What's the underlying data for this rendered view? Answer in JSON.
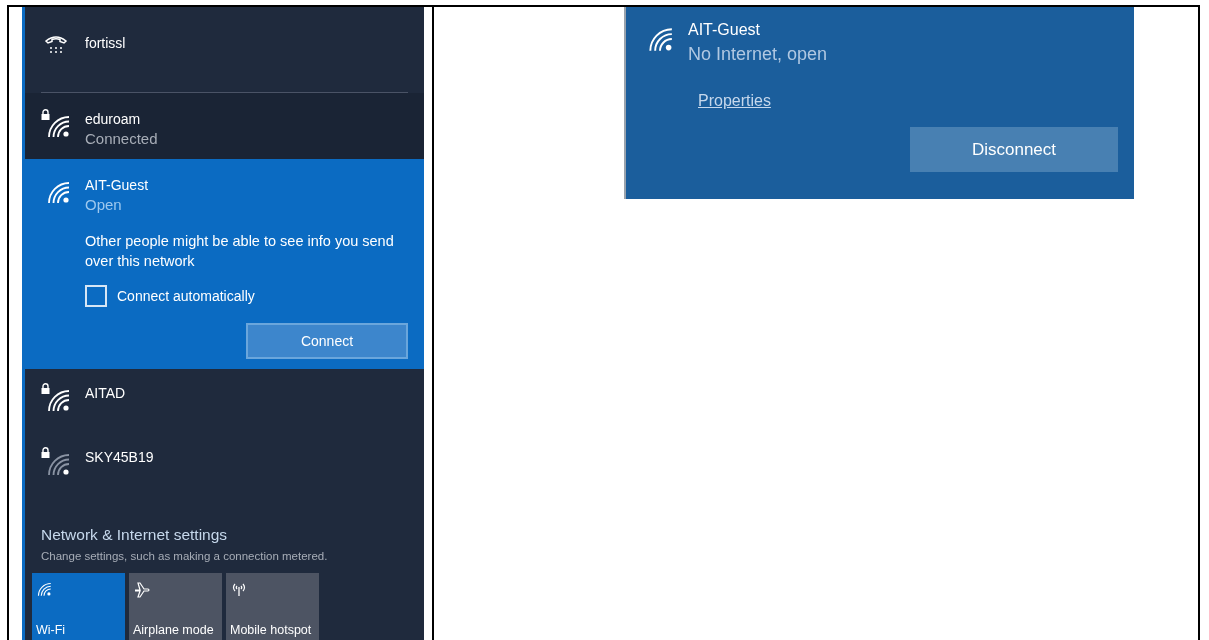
{
  "left_panel": {
    "networks": [
      {
        "kind": "vpn",
        "name": "fortissl",
        "selected": false
      },
      {
        "kind": "wifi",
        "name": "eduroam",
        "status": "Connected",
        "secured": true,
        "selected": false
      },
      {
        "kind": "wifi",
        "name": "AIT-Guest",
        "status": "Open",
        "secured": false,
        "selected": true,
        "warning": "Other people might be able to see info you send over this network",
        "connect_automatically": {
          "label": "Connect automatically",
          "checked": false
        },
        "button": "Connect"
      },
      {
        "kind": "wifi",
        "name": "AITAD",
        "secured": true,
        "selected": false
      },
      {
        "kind": "wifi",
        "name": "SKY45B19",
        "secured": true,
        "selected": false
      }
    ],
    "settings": {
      "title": "Network & Internet settings",
      "subtitle": "Change settings, such as making a connection metered."
    },
    "quick_actions": [
      {
        "kind": "wifi",
        "label": "Wi-Fi",
        "on": true
      },
      {
        "kind": "airplane",
        "label": "Airplane mode",
        "on": false
      },
      {
        "kind": "hotspot",
        "label": "Mobile hotspot",
        "on": false
      }
    ]
  },
  "right_panel": {
    "name": "AIT-Guest",
    "status": "No Internet, open",
    "link": "Properties",
    "button": "Disconnect"
  }
}
